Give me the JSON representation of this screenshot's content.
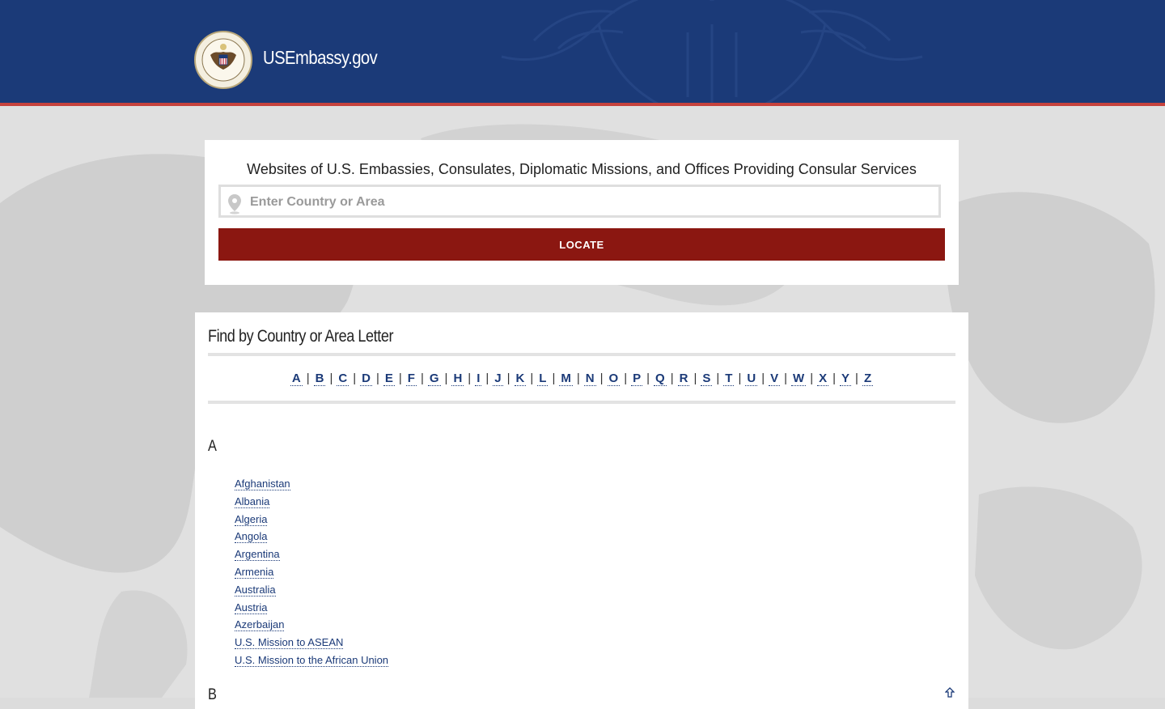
{
  "header": {
    "site_title": "USEmbassy.gov",
    "colors": {
      "navy": "#1b3a78",
      "stripe": "#c6433d"
    }
  },
  "search": {
    "heading": "Websites of U.S. Embassies, Consulates, Diplomatic Missions, and Offices Providing Consular Services",
    "placeholder": "Enter Country or Area",
    "value": "",
    "locate_label": "LOCATE",
    "button_color": "#8b1711"
  },
  "finder": {
    "title": "Find by Country or Area Letter",
    "letters": [
      "A",
      "B",
      "C",
      "D",
      "E",
      "F",
      "G",
      "H",
      "I",
      "J",
      "K",
      "L",
      "M",
      "N",
      "O",
      "P",
      "Q",
      "R",
      "S",
      "T",
      "U",
      "V",
      "W",
      "X",
      "Y",
      "Z"
    ]
  },
  "sections": [
    {
      "letter": "A",
      "countries": [
        "Afghanistan",
        "Albania",
        "Algeria",
        "Angola",
        "Argentina",
        "Armenia",
        "Australia",
        "Austria",
        "Azerbaijan",
        "U.S. Mission to ASEAN",
        "U.S. Mission to the African Union"
      ]
    },
    {
      "letter": "B",
      "countries": []
    }
  ],
  "icons": {
    "location": "map-pin-icon",
    "back_to_top": "arrow-up-icon",
    "seal": "department-of-state-seal-icon"
  }
}
